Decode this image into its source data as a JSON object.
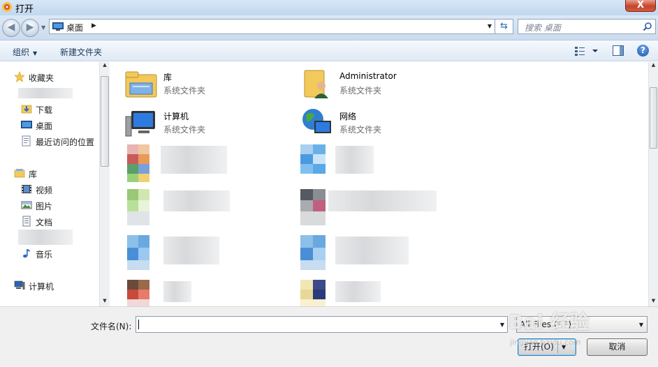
{
  "window": {
    "title": "打开",
    "close_label": "X"
  },
  "address": {
    "location": "桌面",
    "search_placeholder": "搜索 桌面"
  },
  "toolbar": {
    "organize": "组织",
    "new_folder": "新建文件夹"
  },
  "nav": {
    "favorites": "收藏夹",
    "downloads": "下载",
    "desktop": "桌面",
    "recent": "最近访问的位置",
    "libraries": "库",
    "videos": "视频",
    "pictures": "图片",
    "documents": "文档",
    "music": "音乐",
    "computer": "计算机"
  },
  "items": [
    {
      "name": "库",
      "type": "系统文件夹"
    },
    {
      "name": "Administrator",
      "type": "系统文件夹"
    },
    {
      "name": "计算机",
      "type": "系统文件夹"
    },
    {
      "name": "网络",
      "type": "系统文件夹"
    }
  ],
  "footer": {
    "filename_label": "文件名(N):",
    "filename_value": "",
    "filter": "All Files (*.*)",
    "open_button": "打开(O)",
    "cancel_button": "取消"
  },
  "watermark": {
    "text": "Bai 经验",
    "sub": "jingyan.baidu.com"
  }
}
